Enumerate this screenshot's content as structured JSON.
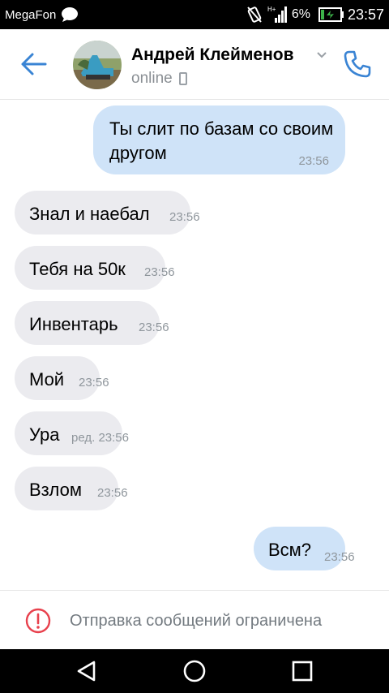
{
  "status_bar": {
    "carrier": "MegaFon",
    "battery_percent": "6%",
    "time": "23:57",
    "network_label": "H+"
  },
  "header": {
    "contact_name": "Андрей Клейменов",
    "status": "online"
  },
  "messages": [
    {
      "direction": "out",
      "lines": [
        "Ты слит по базам со своим",
        "другом"
      ],
      "time": "23:56"
    },
    {
      "direction": "in",
      "text": "Знал и наебал",
      "time": "23:56"
    },
    {
      "direction": "in",
      "text": "Тебя на 50к",
      "time": "23:56"
    },
    {
      "direction": "in",
      "text": "Инвентарь",
      "time": "23:56"
    },
    {
      "direction": "in",
      "text": "Мой",
      "time": "23:56"
    },
    {
      "direction": "in",
      "text": "Ура",
      "time": "ред. 23:56"
    },
    {
      "direction": "in",
      "text": "Взлом",
      "time": "23:56"
    },
    {
      "direction": "out",
      "text": "Всм?",
      "time": "23:56"
    }
  ],
  "footer": {
    "restricted_text": "Отправка сообщений ограничена"
  },
  "colors": {
    "accent": "#3a84d4",
    "outgoing_bubble": "#cfe3f8",
    "incoming_bubble": "#ebebef",
    "warning": "#e8414d"
  },
  "icons": {
    "back": "arrow-left-icon",
    "call": "phone-icon",
    "warning": "alert-circle-icon"
  }
}
